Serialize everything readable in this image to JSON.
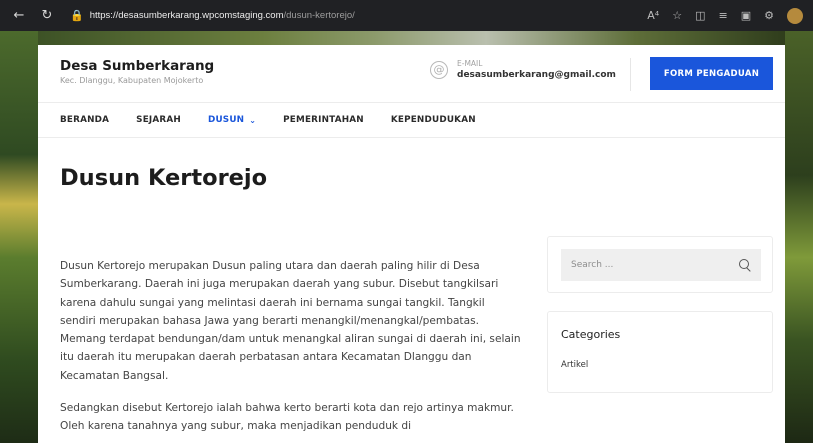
{
  "browser": {
    "url_host": "https://desasumberkarang.wpcomstaging.com",
    "url_path": "/dusun-kertorejo/"
  },
  "site": {
    "title": "Desa Sumberkarang",
    "tagline": "Kec. Dlanggu, Kabupaten Mojokerto"
  },
  "contact": {
    "label": "E-MAIL",
    "email": "desasumberkarang@gmail.com"
  },
  "header": {
    "form_button": "FORM PENGADUAN"
  },
  "nav": {
    "items": [
      {
        "label": "BERANDA"
      },
      {
        "label": "SEJARAH"
      },
      {
        "label": "DUSUN"
      },
      {
        "label": "PEMERINTAHAN"
      },
      {
        "label": "KEPENDUDUKAN"
      }
    ]
  },
  "page": {
    "title": "Dusun Kertorejo",
    "paragraphs": [
      "Dusun Kertorejo merupakan Dusun paling utara dan daerah paling hilir di Desa Sumberkarang. Daerah ini juga merupakan daerah yang subur. Disebut tangkilsari karena dahulu sungai yang melintasi daerah ini bernama sungai tangkil. Tangkil sendiri merupakan bahasa Jawa yang berarti menangkil/menangkal/pembatas. Memang terdapat bendungan/dam untuk menangkal aliran sungai di daerah ini, selain itu daerah itu merupakan daerah perbatasan antara Kecamatan Dlanggu dan Kecamatan Bangsal.",
      "Sedangkan disebut Kertorejo ialah bahwa kerto berarti kota dan rejo artinya makmur. Oleh karena tanahnya yang subur, maka menjadikan penduduk di"
    ]
  },
  "sidebar": {
    "search_placeholder": "Search ...",
    "categories_title": "Categories",
    "categories": [
      "Artikel"
    ]
  },
  "colors": {
    "accent": "#1a56db"
  }
}
